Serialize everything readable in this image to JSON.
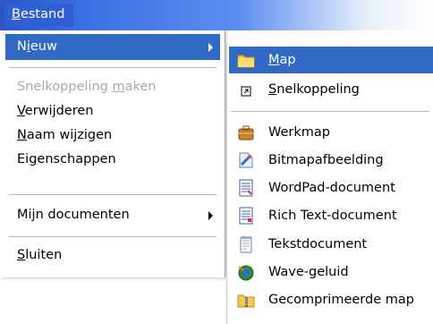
{
  "menubar": {
    "item": "Bestand"
  },
  "file_menu": {
    "new": "Nieuw",
    "create_shortcut": "Snelkoppeling maken",
    "delete": "Verwijderen",
    "rename": "Naam wijzigen",
    "properties": "Eigenschappen",
    "my_documents": "Mijn documenten",
    "close": "Sluiten"
  },
  "new_submenu": {
    "folder": "Map",
    "shortcut": "Snelkoppeling",
    "briefcase": "Werkmap",
    "bitmap": "Bitmapafbeelding",
    "wordpad": "WordPad-document",
    "rtf": "Rich Text-document",
    "text": "Tekstdocument",
    "wave": "Wave-geluid",
    "zip": "Gecomprimeerde map"
  },
  "colors": {
    "highlight": "#316ac5",
    "menubar": "#3c70e3",
    "disabled": "#a9a9a9"
  }
}
